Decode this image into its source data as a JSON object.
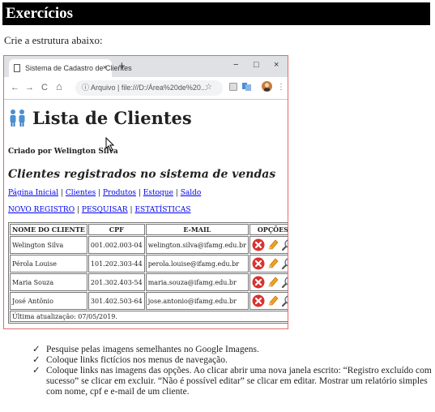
{
  "doc": {
    "heading": "Exercícios",
    "intro": "Crie a estrutura abaixo:"
  },
  "browser": {
    "tab_title": "Sistema de Cadastro de Clientes",
    "tab_close": "×",
    "new_tab": "+",
    "minimize": "−",
    "maximize": "□",
    "close": "×",
    "back": "←",
    "forward": "→",
    "reload": "C",
    "home": "⌂",
    "address": "ⓘ  Arquivo  |  file:///D:/Área%20de%20...",
    "star": "☆",
    "menu": "⋮"
  },
  "page": {
    "title": "Lista de Clientes",
    "byline": "Criado por Welington Silva",
    "subtitle": "Clientes registrados no sistema de vendas",
    "nav_primary": [
      "Página Inicial",
      "Clientes",
      "Produtos",
      "Estoque",
      "Saldo"
    ],
    "nav_secondary": [
      "NOVO REGISTRO",
      "PESQUISAR",
      "ESTATÍSTICAS"
    ],
    "separator": "|"
  },
  "table": {
    "headers": [
      "NOME DO CLIENTE",
      "CPF",
      "E-MAIL",
      "OPÇÕES"
    ],
    "rows": [
      {
        "name": "Welington Silva",
        "cpf": "001.002.003-04",
        "email": "welington.silva@ifamg.edu.br"
      },
      {
        "name": "Pérola Louise",
        "cpf": "101.202.303-44",
        "email": "perola.louise@ifamg.edu.br"
      },
      {
        "name": "Maria Souza",
        "cpf": "201.302.403-54",
        "email": "maria.souza@ifamg.edu.br"
      },
      {
        "name": "José Antônio",
        "cpf": "301.402.503-64",
        "email": "jose.antonio@ifamg.edu.br"
      }
    ],
    "footer": "Última atualização: 07/05/2019."
  },
  "icons": {
    "people": "people-icon",
    "delete": "delete-icon",
    "edit": "edit-pencil-icon",
    "view": "magnifier-icon"
  },
  "colors": {
    "delete_red": "#d9322f",
    "pencil_orange": "#f0a020",
    "people_blue": "#4a8fd6",
    "link_blue": "#0000ee",
    "window_border": "#e06b6b"
  },
  "instructions": [
    "Pesquise pelas imagens semelhantes no Google Imagens.",
    "Coloque links fictícios nos menus de navegação.",
    "Coloque links nas imagens das opções. Ao clicar abrir uma nova janela escrito: “Registro excluído com sucesso” se clicar em excluir. “Não é possível editar” se clicar em editar. Mostrar um relatório simples com nome, cpf e e-mail de um cliente."
  ],
  "check_mark": "✓"
}
